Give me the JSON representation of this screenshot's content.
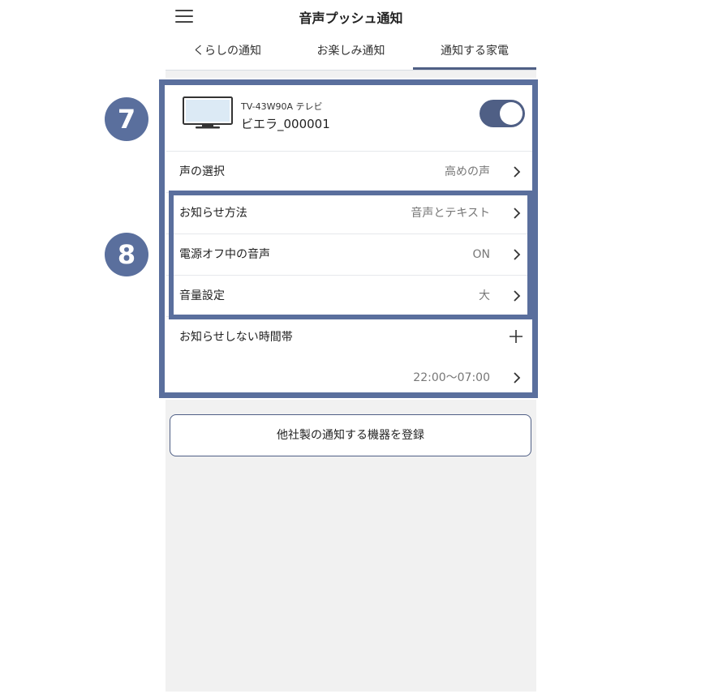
{
  "header": {
    "title": "音声プッシュ通知",
    "tabs": [
      {
        "label": "くらしの通知",
        "active": false
      },
      {
        "label": "お楽しみ通知",
        "active": false
      },
      {
        "label": "通知する家電",
        "active": true
      }
    ]
  },
  "device": {
    "model": "TV-43W90A テレビ",
    "name": "ビエラ_000001",
    "enabled": true,
    "icon": "tv-icon"
  },
  "settings": [
    {
      "label": "声の選択",
      "value": "高めの声"
    },
    {
      "label": "お知らせ方法",
      "value": "音声とテキスト"
    },
    {
      "label": "電源オフ中の音声",
      "value": "ON"
    },
    {
      "label": "音量設定",
      "value": "大"
    },
    {
      "label": "お知らせしない時間帯",
      "value": ""
    },
    {
      "label": "",
      "value": "22:00〜07:00"
    }
  ],
  "badges": {
    "first": "7",
    "second": "8"
  },
  "register_button": "他社製の通知する機器を登録",
  "colors": {
    "accent": "#4f5f85",
    "highlight": "#5a6f9d",
    "background": "#f1f1f1"
  }
}
